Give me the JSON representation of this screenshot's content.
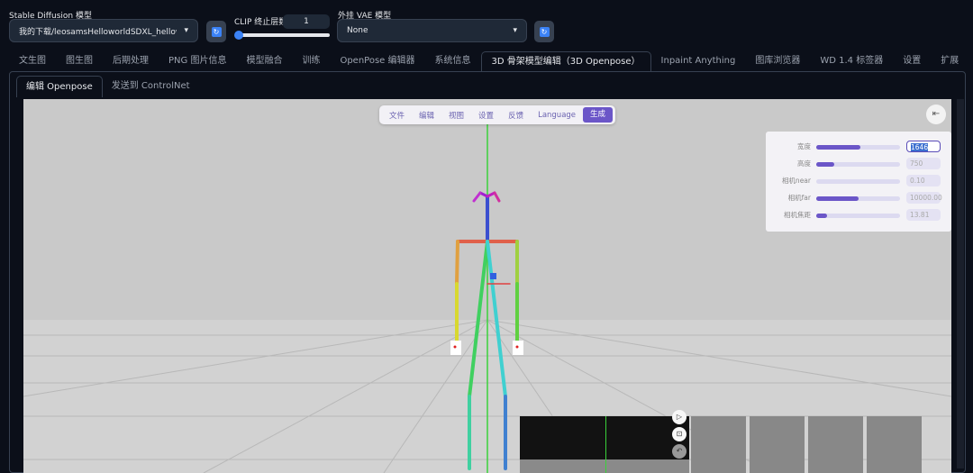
{
  "top": {
    "sd_model_label": "Stable Diffusion 模型",
    "sd_model_value": "我的下载/leosamsHelloworldSDXL_helloworldS",
    "clip_label": "CLIP 终止层数",
    "clip_value": "1",
    "clip_slider_fraction": 0.0,
    "vae_label": "外挂 VAE 模型",
    "vae_value": "None"
  },
  "tabs": [
    "文生图",
    "图生图",
    "后期处理",
    "PNG 图片信息",
    "模型融合",
    "训练",
    "OpenPose 编辑器",
    "系统信息",
    "3D 骨架模型编辑（3D Openpose）",
    "Inpaint Anything",
    "图库浏览器",
    "WD 1.4 标签器",
    "设置",
    "扩展"
  ],
  "active_tab": "3D 骨架模型编辑（3D Openpose）",
  "subtabs": [
    "编辑 Openpose",
    "发送到 ControlNet"
  ],
  "menu": [
    "文件",
    "编辑",
    "视图",
    "设置",
    "反馈",
    "Language",
    "生成"
  ],
  "settings": [
    {
      "label": "宽度",
      "value": "1646",
      "fraction": 0.53
    },
    {
      "label": "高度",
      "value": "750",
      "fraction": 0.22
    },
    {
      "label": "相机near",
      "value": "0.10",
      "fraction": 0.0
    },
    {
      "label": "相机far",
      "value": "10000.00",
      "fraction": 0.5
    },
    {
      "label": "相机焦距",
      "value": "13.81",
      "fraction": 0.13
    }
  ],
  "accent": "#6b56c8"
}
